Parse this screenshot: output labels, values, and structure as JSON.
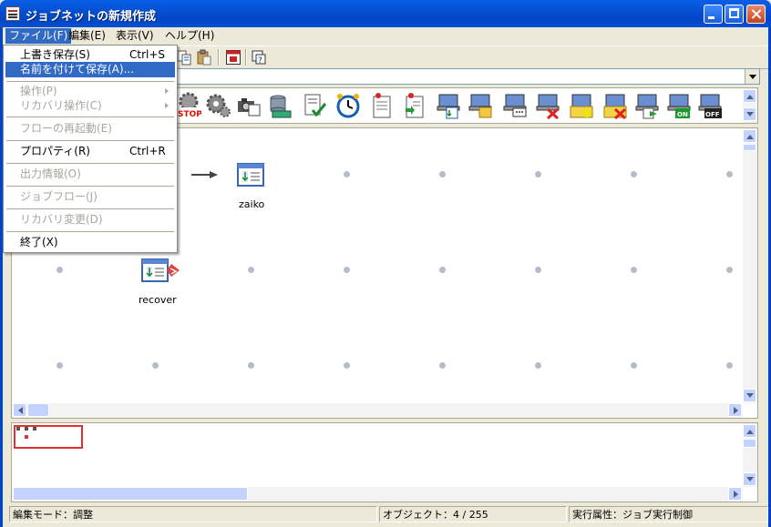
{
  "window": {
    "title": "ジョブネットの新規作成"
  },
  "menubar": {
    "items": [
      "ファイル(F)",
      "編集(E)",
      "表示(V)",
      "ヘルプ(H)"
    ]
  },
  "file_menu": {
    "items": [
      {
        "label": "上書き保存(S)",
        "shortcut": "Ctrl+S",
        "disabled": false,
        "highlighted": false
      },
      {
        "label": "名前を付けて保存(A)...",
        "shortcut": "",
        "disabled": false,
        "highlighted": true
      },
      {
        "label": "操作(P)",
        "shortcut": "",
        "disabled": true,
        "submenu": true
      },
      {
        "label": "リカバリ操作(C)",
        "shortcut": "",
        "disabled": true,
        "submenu": true
      },
      {
        "label": "フローの再起動(E)",
        "shortcut": "",
        "disabled": true
      },
      {
        "label": "プロパティ(R)",
        "shortcut": "Ctrl+R",
        "disabled": false
      },
      {
        "label": "出力情報(O)",
        "shortcut": "",
        "disabled": true
      },
      {
        "label": "ジョブフロー(J)",
        "shortcut": "",
        "disabled": true
      },
      {
        "label": "リカバリ変更(D)",
        "shortcut": "",
        "disabled": true
      },
      {
        "label": "終了(X)",
        "shortcut": "",
        "disabled": false
      }
    ]
  },
  "canvas": {
    "nodes": [
      {
        "label": "zaiko",
        "icon": "job-document-icon"
      },
      {
        "label": "recover",
        "icon": "recover-job-icon"
      }
    ]
  },
  "palette": {
    "icons": [
      "stop-icon",
      "gears-icon",
      "camera-printer-icon",
      "database-icon",
      "report-check-icon",
      "alarm-clock-icon",
      "clipboard-job-icon",
      "clipboard-arrow-icon",
      "pc-job-icon",
      "pc-folder-icon",
      "pc-message-icon",
      "pc-delete-icon",
      "folder-add-icon",
      "folder-delete-icon",
      "pc-transfer-icon",
      "pc-on-icon",
      "pc-off-icon"
    ],
    "stop_text": "STOP",
    "on_text": "ON",
    "off_text": "OFF"
  },
  "statusbar": {
    "mode": "編集モード：調整",
    "objects": "オブジェクト：4 / 255",
    "attribute": "実行属性：ジョブ実行制御"
  },
  "colors": {
    "titlebar": "#0450d2",
    "menu_highlight": "#316ac5",
    "canvas_bg": "#ffffff",
    "overview_box": "#e03030"
  }
}
